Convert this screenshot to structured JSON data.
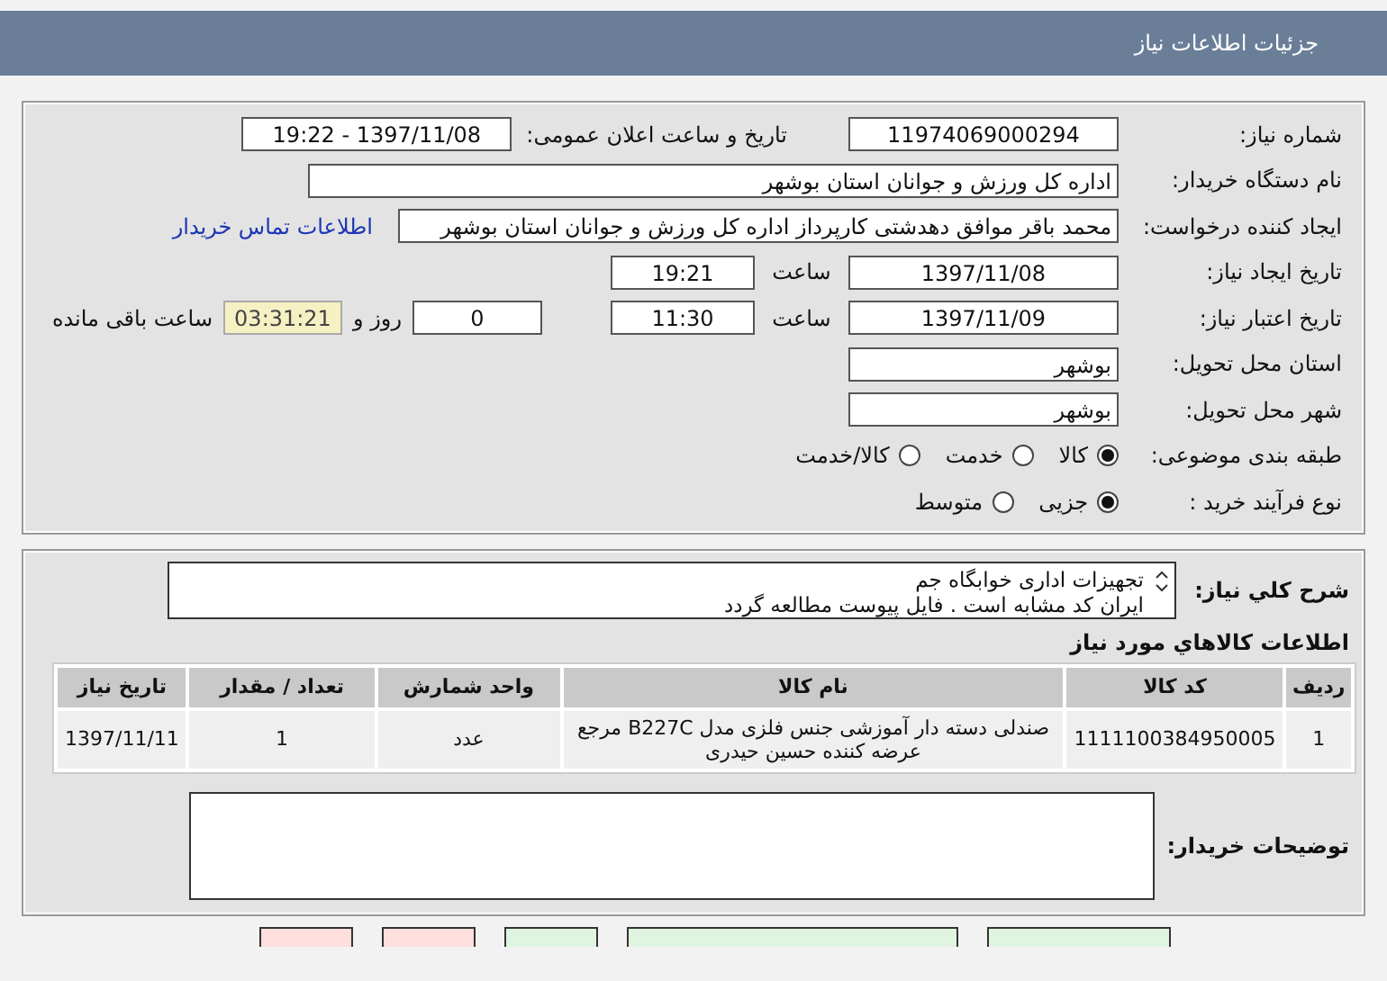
{
  "header": {
    "title": "جزئیات اطلاعات نیاز"
  },
  "details": {
    "need_number": {
      "label": "شماره نیاز:",
      "value": "11974069000294"
    },
    "announce": {
      "label": "تاریخ و ساعت اعلان عمومی:",
      "value": "1397/11/08 - 19:22"
    },
    "buyer_org": {
      "label": "نام دستگاه خریدار:",
      "value": "اداره کل ورزش و جوانان استان بوشهر"
    },
    "requester": {
      "label": "ایجاد کننده درخواست:",
      "value": "محمد باقر موافق دهدشتی کارپرداز اداره کل ورزش و جوانان استان بوشهر",
      "link": "اطلاعات تماس خریدار"
    },
    "created": {
      "label": "تاریخ ایجاد نیاز:",
      "date": "1397/11/08",
      "time_label": "ساعت",
      "time": "19:21"
    },
    "valid": {
      "label": "تاریخ اعتبار نیاز:",
      "date": "1397/11/09",
      "time_label": "ساعت",
      "time": "11:30",
      "days": "0",
      "days_label": "روز و",
      "remaining": "03:31:21",
      "remaining_label": "ساعت باقی مانده"
    },
    "province": {
      "label": "استان محل تحویل:",
      "value": "بوشهر"
    },
    "city": {
      "label": "شهر محل تحویل:",
      "value": "بوشهر"
    },
    "category": {
      "label": "طبقه بندی موضوعی:",
      "options": [
        {
          "label": "کالا",
          "selected": true
        },
        {
          "label": "خدمت",
          "selected": false
        },
        {
          "label": "کالا/خدمت",
          "selected": false
        }
      ]
    },
    "process": {
      "label": "نوع فرآیند خرید :",
      "options": [
        {
          "label": "جزیی",
          "selected": true
        },
        {
          "label": "متوسط",
          "selected": false
        }
      ]
    }
  },
  "summary": {
    "label": "شرح کلي نياز:",
    "lines": [
      "تجهیزات اداری خوابگاه جم",
      "ایران کد مشابه است . فایل پیوست مطالعه گردد"
    ]
  },
  "goods": {
    "title": "اطلاعات کالاهاي مورد نياز",
    "columns": [
      "ردیف",
      "کد کالا",
      "نام کالا",
      "واحد شمارش",
      "تعداد / مقدار",
      "تاریخ نیاز"
    ],
    "rows": [
      [
        "1",
        "1111100384950005",
        "صندلی دسته دار آموزشی جنس فلزی مدل B227C مرجع عرضه کننده حسین حیدری",
        "عدد",
        "1",
        "1397/11/11"
      ]
    ]
  },
  "buyer_notes": {
    "label": "توضیحات خریدار:"
  },
  "buttons": [
    {
      "color": "#dff5df"
    },
    {
      "color": "#dff5df"
    },
    {
      "color": "#dff5df"
    },
    {
      "color": "#ffdede"
    },
    {
      "color": "#ffdede"
    }
  ]
}
